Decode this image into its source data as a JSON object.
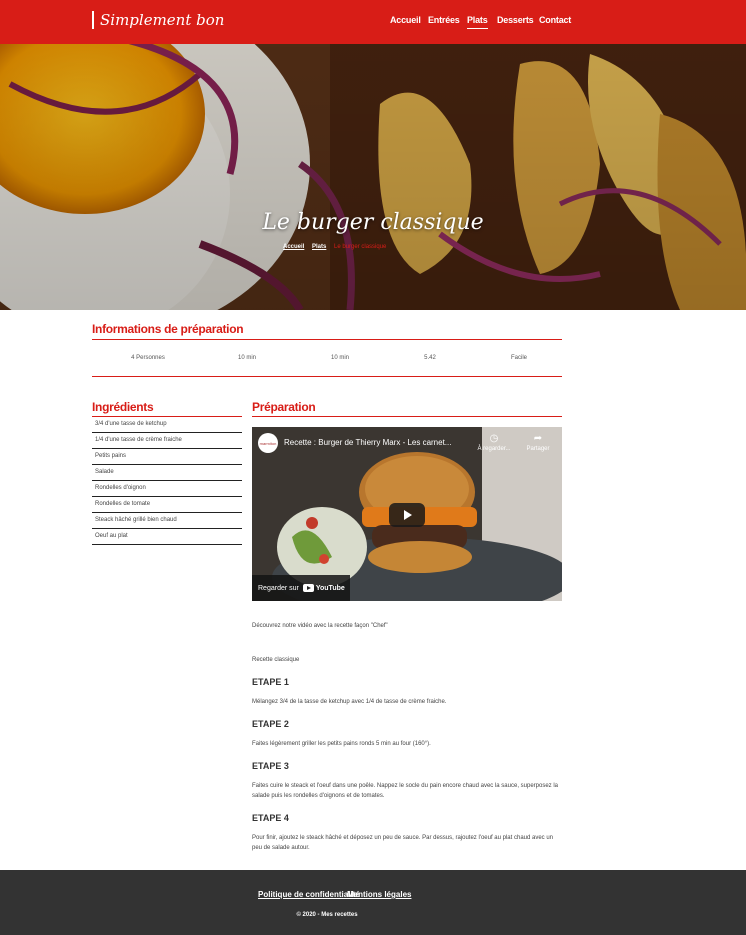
{
  "header": {
    "logo": "Simplement bon",
    "nav": [
      {
        "label": "Accueil",
        "active": false
      },
      {
        "label": "Entrées",
        "active": false
      },
      {
        "label": "Plats",
        "active": true
      },
      {
        "label": "Desserts",
        "active": false
      },
      {
        "label": "Contact",
        "active": false
      }
    ]
  },
  "hero": {
    "title": "Le burger classique",
    "breadcrumb": [
      "Accueil",
      "Plats",
      "Le burger classique"
    ]
  },
  "prep_info": {
    "title": "Informations de préparation",
    "values": [
      "4 Personnes",
      "10 min",
      "10 min",
      "5.42",
      "Facile"
    ]
  },
  "ingredients": {
    "title": "Ingrédients",
    "items": [
      "3/4 d'une tasse de ketchup",
      "1/4 d'une tasse de crème fraiche",
      "Petits pains",
      "Salade",
      "Rondelles d'oignon",
      "Rondelles de tomate",
      "Steack hâché grillé bien chaud",
      "Oeuf au plat"
    ]
  },
  "preparation": {
    "title": "Préparation",
    "video": {
      "title": "Recette : Burger de Thierry Marx - Les carnet...",
      "channel": "marmiton",
      "watch_later": "À regarder...",
      "share": "Partager",
      "watch_on": "Regarder sur",
      "youtube": "YouTube"
    },
    "intro": "Découvrez notre vidéo avec la recette façon \"Chef\"",
    "subtitle": "Recette classique",
    "steps": [
      {
        "title": "ETAPE 1",
        "text": "Mélangez 3/4 de la tasse de ketchup avec 1/4 de tasse de crème fraiche."
      },
      {
        "title": "ETAPE 2",
        "text": "Faites légèrement griller les petits pains ronds 5 min au four (160°)."
      },
      {
        "title": "ETAPE 3",
        "text": "Faites cuire le steack et l'oeuf dans une poêle. Nappez le socle du pain encore chaud avec la sauce, superposez la salade puis les rondelles d'oignons et de tomates."
      },
      {
        "title": "ETAPE 4",
        "text": "Pour finir, ajoutez le steack hâché et déposez un peu de sauce. Par dessus, rajoutez l'oeuf au plat chaud avec un peu de salade autour."
      }
    ]
  },
  "footer": {
    "links": [
      "Politique de confidentialité",
      "Mentions légales"
    ],
    "copyright": "© 2020 - Mes recettes"
  },
  "colors": {
    "accent": "#d81d17",
    "footer": "#333333"
  }
}
